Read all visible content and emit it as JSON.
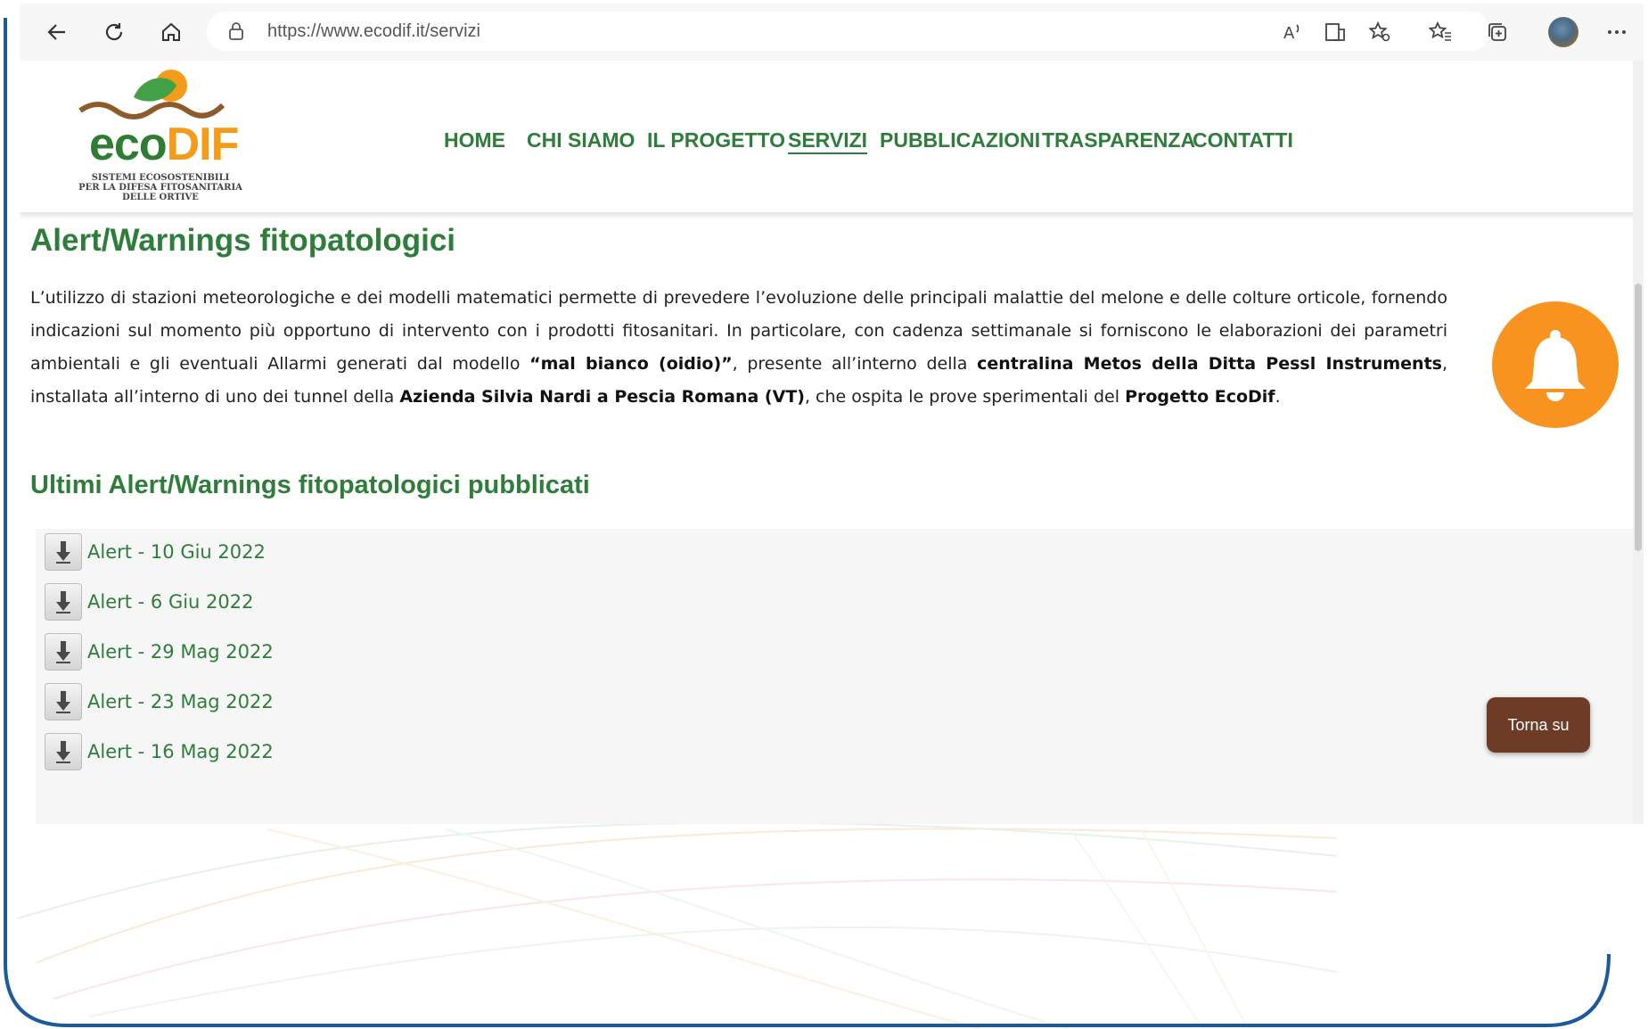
{
  "browser": {
    "url": "https://www.ecodif.it/servizi",
    "icons": [
      "back-icon",
      "refresh-icon",
      "home-icon",
      "lock-icon",
      "read-aloud-icon",
      "immersive-reader-icon",
      "add-favorite-icon",
      "favorites-icon",
      "collections-icon",
      "profile-avatar",
      "more-icon"
    ]
  },
  "logo": {
    "word_eco": "eco",
    "word_dif": "DIF",
    "tagline_1": "Sistemi Ecosostenibili",
    "tagline_2": "per la difesa fitosanitaria",
    "tagline_3": "delle ortive"
  },
  "nav": {
    "items": [
      {
        "label": "HOME"
      },
      {
        "label": "CHI SIAMO"
      },
      {
        "label": "IL PROGETTO"
      },
      {
        "label": "SERVIZI"
      },
      {
        "label": "PUBBLICAZIONI"
      },
      {
        "label": "TRASPARENZA"
      },
      {
        "label": "CONTATTI"
      }
    ],
    "active": "SERVIZI"
  },
  "main": {
    "title": "Alert/Warnings fitopatologici",
    "intro": {
      "p1": "L’utilizzo di stazioni meteorologiche e dei modelli matematici permette di prevedere l’evoluzione delle principali malattie del melone e delle colture orticole, fornendo indicazioni sul momento più opportuno di intervento con i prodotti fitosanitari. In particolare, con cadenza settimanale si forniscono le elaborazioni dei parametri ambientali e gli eventuali Allarmi generati dal modello ",
      "b1": "“mal bianco (oidio)”",
      "p2": ", presente all’interno della ",
      "b2": "centralina Metos della Ditta Pessl Instruments",
      "p3": ", installata all’interno di uno dei tunnel della ",
      "b3": "Azienda Silvia Nardi a Pescia Romana (VT)",
      "p4": ", che ospita le prove sperimentali del ",
      "b4": "Progetto EcoDif",
      "p5": "."
    },
    "subtitle": "Ultimi Alert/Warnings fitopatologici pubblicati",
    "alerts": [
      {
        "label": "Alert - 10 Giu 2022"
      },
      {
        "label": "Alert - 6 Giu 2022"
      },
      {
        "label": "Alert - 29 Mag 2022"
      },
      {
        "label": "Alert - 23 Mag 2022"
      },
      {
        "label": "Alert - 16 Mag 2022"
      }
    ],
    "back_to_top": "Torna su"
  },
  "colors": {
    "brand_green": "#2e7d3a",
    "brand_orange": "#f7931e",
    "back_to_top_bg": "#6e3b27"
  }
}
